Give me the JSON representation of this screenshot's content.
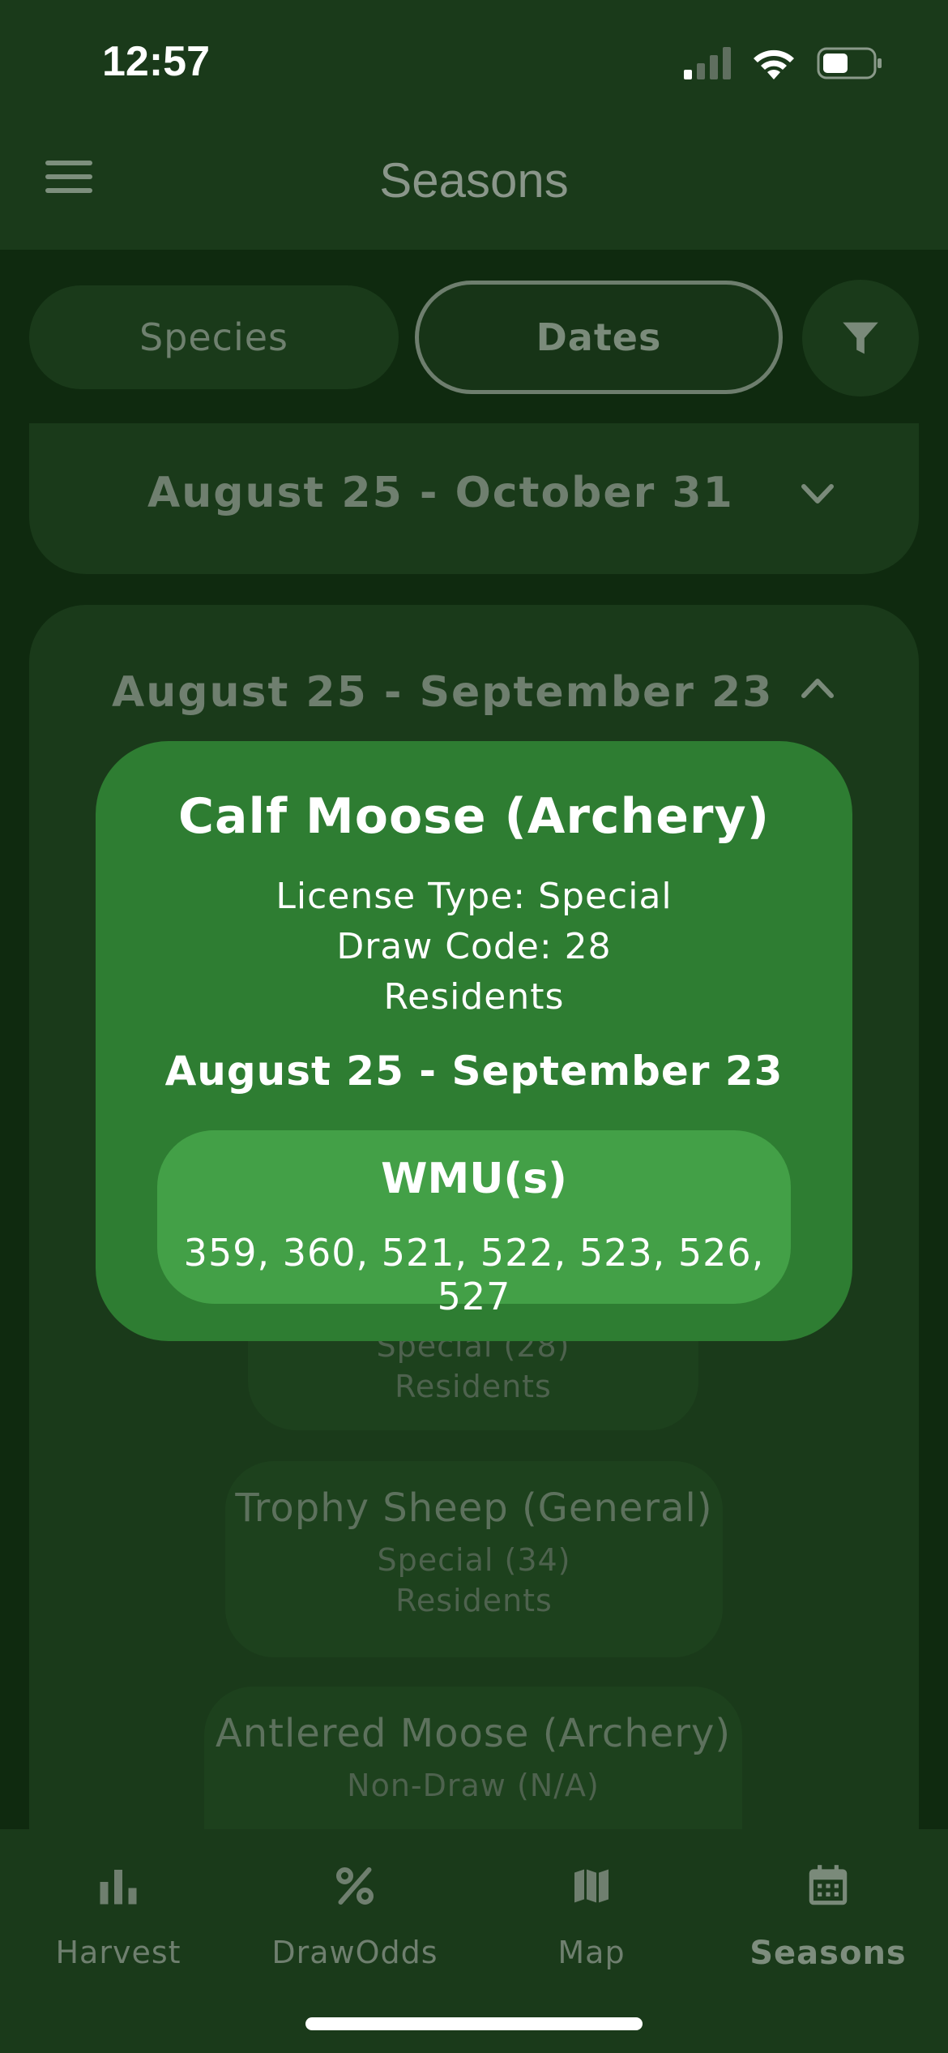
{
  "status_bar": {
    "time": "12:57"
  },
  "header": {
    "title": "Seasons"
  },
  "segments": {
    "species": "Species",
    "dates": "Dates"
  },
  "cards": {
    "collapsed": {
      "title": "August 25 - October 31"
    },
    "expanded": {
      "title": "August 25 - September 23",
      "items": [
        {
          "name": "Trophy Sheep (General)",
          "license": "Special (34)",
          "residency": "Residents"
        },
        {
          "name": "Antlered Moose (Archery)",
          "license": "Non-Draw (N/A)"
        }
      ],
      "partial_item": {
        "license": "Special (28)",
        "residency": "Residents"
      }
    }
  },
  "popup": {
    "title": "Calf Moose (Archery)",
    "license_type": "License Type: Special",
    "draw_code": "Draw Code: 28",
    "residency": "Residents",
    "dates": "August 25 - September 23",
    "wmu_title": "WMU(s)",
    "wmu_list": "359, 360, 521, 522, 523, 526, 527"
  },
  "nav": {
    "items": [
      {
        "label": "Harvest",
        "icon": "bar-chart-icon"
      },
      {
        "label": "DrawOdds",
        "icon": "percent-icon"
      },
      {
        "label": "Map",
        "icon": "map-icon"
      },
      {
        "label": "Seasons",
        "icon": "calendar-icon"
      }
    ],
    "active": "Seasons"
  },
  "colors": {
    "background": "#0f2a0f",
    "surface": "#1a3a1a",
    "popup": "#2e7d32",
    "wmu_box": "#43a047"
  }
}
